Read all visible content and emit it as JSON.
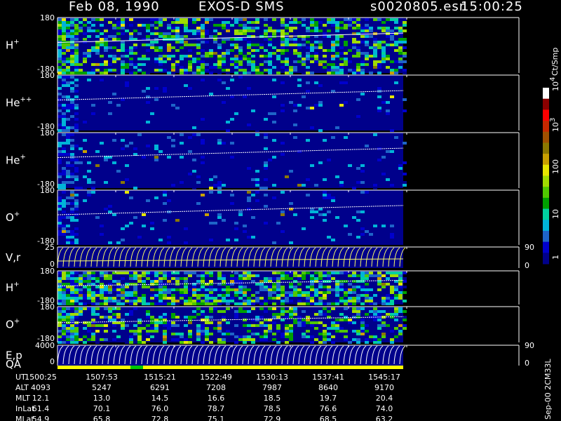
{
  "header": {
    "date": "Feb 08, 1990",
    "instrument": "EXOS-D SMS",
    "filename": "s0020805.esr",
    "time": "15:00:25"
  },
  "colorbar": {
    "units_label": "Ct/Smp",
    "scale": "log",
    "range": [
      1,
      10000
    ],
    "tick_labels": [
      "1",
      "10",
      "100",
      "10",
      "10"
    ],
    "tick_superscripts": [
      "",
      "",
      "",
      "3",
      "4"
    ],
    "colors": [
      "#00008b",
      "#0000cd",
      "#1e64c8",
      "#00b4d8",
      "#00d0a0",
      "#00a000",
      "#50c800",
      "#a0dc00",
      "#e6e600",
      "#c8a000",
      "#8c7800",
      "#a05000",
      "#c82800",
      "#ff0000",
      "#8b0000",
      "#ffffff"
    ]
  },
  "palette": {
    "background": "#000000",
    "field_bg": "#00008b",
    "axis": "#ffffff",
    "pitch_curve": "#ffffff",
    "velocity_curve": "#ffff66",
    "qa_good": "#ffff00",
    "qa_flag": "#00c800"
  },
  "panels": [
    {
      "species": "H",
      "charge": "+",
      "ymax": "180",
      "ymin": "-180"
    },
    {
      "species": "He",
      "charge": "++",
      "ymax": "180",
      "ymin": "-180"
    },
    {
      "species": "He",
      "charge": "+",
      "ymax": "180",
      "ymin": "-180"
    },
    {
      "species": "O",
      "charge": "+",
      "ymax": "180",
      "ymin": "-180"
    },
    {
      "label": "V,r",
      "ymax": "25",
      "ymin": "0",
      "right_top": "90",
      "right_bottom": "0"
    },
    {
      "species": "H",
      "charge": "+",
      "ymax": "180",
      "ymin": "-180"
    },
    {
      "species": "O",
      "charge": "+",
      "ymax": "180",
      "ymin": "-180"
    },
    {
      "label": "E,p",
      "ymax": "4000",
      "ymin": "0",
      "right_top": "90",
      "right_bottom": "0"
    }
  ],
  "qa_label": "QA",
  "orbit_table": {
    "rows": [
      {
        "name": "UT",
        "values": [
          "1500:25",
          "1507:53",
          "1515:21",
          "1522:49",
          "1530:13",
          "1537:41",
          "1545:17"
        ]
      },
      {
        "name": "ALT",
        "values": [
          "4093",
          "5247",
          "6291",
          "7208",
          "7987",
          "8640",
          "9170"
        ]
      },
      {
        "name": "MLT",
        "values": [
          "12.1",
          "13.0",
          "14.5",
          "16.6",
          "18.5",
          "19.7",
          "20.4"
        ]
      },
      {
        "name": "InLat",
        "values": [
          "61.4",
          "70.1",
          "76.0",
          "78.7",
          "78.5",
          "76.6",
          "74.0"
        ]
      },
      {
        "name": "MLat",
        "values": [
          "54.9",
          "65.8",
          "72.8",
          "75.1",
          "72.9",
          "68.5",
          "63.2"
        ]
      }
    ]
  },
  "footer_vertical": "Sep-00  2CM33L",
  "chart_data": {
    "type": "heatmap",
    "title": "Feb 08, 1990   EXOS-D SMS",
    "x_tick_labels_UT": [
      "1500:25",
      "1507:53",
      "1515:21",
      "1522:49",
      "1530:13",
      "1537:41",
      "1545:17"
    ],
    "y_range_pitch_angle": [
      -180,
      180
    ],
    "color_scale": {
      "label": "Ct/Smp",
      "type": "log",
      "range": [
        1,
        10000
      ]
    },
    "series": [
      {
        "name": "H+",
        "ylim": [
          -180,
          180
        ]
      },
      {
        "name": "He++",
        "ylim": [
          -180,
          180
        ]
      },
      {
        "name": "He+",
        "ylim": [
          -180,
          180
        ]
      },
      {
        "name": "O+",
        "ylim": [
          -180,
          180
        ]
      },
      {
        "name": "V,r",
        "ylim": [
          0,
          25
        ]
      },
      {
        "name": "H+",
        "ylim": [
          -180,
          180
        ]
      },
      {
        "name": "O+",
        "ylim": [
          -180,
          180
        ]
      },
      {
        "name": "E,p",
        "ylim": [
          0,
          4000
        ]
      }
    ]
  }
}
